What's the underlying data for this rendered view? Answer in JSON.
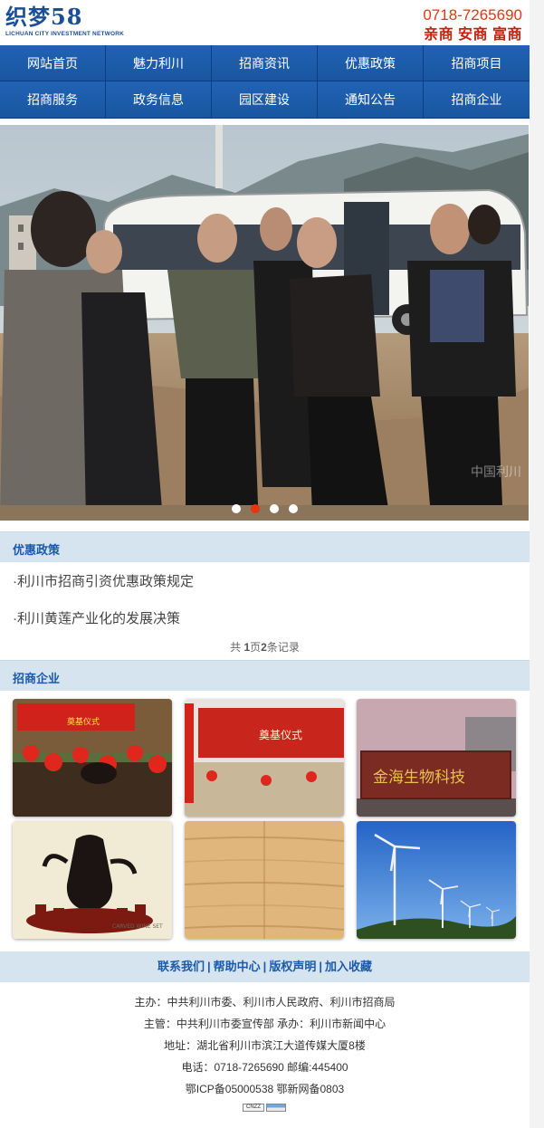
{
  "header": {
    "logo_main": "织梦58",
    "logo_sub": "LICHUAN CITY INVESTMENT NETWORK",
    "phone": "0718-7265690",
    "slogan": "亲商 安商 富商"
  },
  "nav": {
    "items": [
      {
        "label": "网站首页"
      },
      {
        "label": "魅力利川"
      },
      {
        "label": "招商资讯"
      },
      {
        "label": "优惠政策"
      },
      {
        "label": "招商项目"
      },
      {
        "label": "招商服务"
      },
      {
        "label": "政务信息"
      },
      {
        "label": "园区建设"
      },
      {
        "label": "通知公告"
      },
      {
        "label": "招商企业"
      }
    ]
  },
  "banner": {
    "slides": 4,
    "active_slide": 2,
    "watermark": "中国利川"
  },
  "policy": {
    "title": "优惠政策",
    "items": [
      {
        "label": "·利川市招商引资优惠政策规定"
      },
      {
        "label": "·利川黄莲产业化的发展决策"
      }
    ],
    "pager": {
      "prefix": "共 ",
      "pages": "1",
      "mid": "页",
      "records": "2",
      "suffix": "条记录"
    }
  },
  "enterprise": {
    "title": "招商企业",
    "tiles": [
      {
        "caption": "奠基仪式"
      },
      {
        "caption": "奠基仪式"
      },
      {
        "caption": "金海生物科技"
      },
      {
        "caption": "CARVED WINE SET"
      },
      {
        "caption": ""
      },
      {
        "caption": ""
      }
    ]
  },
  "footer": {
    "links": [
      "联系我们",
      "帮助中心",
      "版权声明",
      "加入收藏"
    ],
    "lines": [
      "主办：中共利川市委、利川市人民政府、利川市招商局",
      "主管：中共利川市委宣传部 承办：利川市新闻中心",
      "地址：湖北省利川市滨江大道传媒大厦8楼",
      "电话：0718-7265690 邮编:445400",
      "鄂ICP备05000538 鄂新网备0803"
    ],
    "counter_label": "CNZZ"
  },
  "colors": {
    "brand_blue": "#1b5aa8",
    "accent_red": "#e8340f",
    "section_bg": "#d6e4ef"
  }
}
